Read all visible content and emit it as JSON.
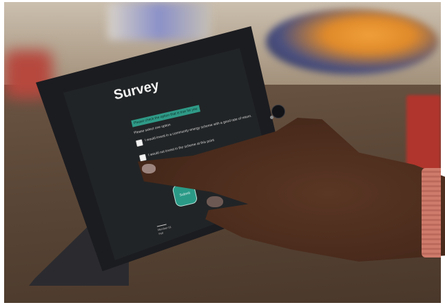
{
  "survey": {
    "title": "Survey",
    "hint": "Please check the option that is true for you",
    "instruction": "Please select one option",
    "options": [
      {
        "label": "I would invest in a community energy scheme with a good rate of return."
      },
      {
        "label": "I would not invest in the scheme at this point"
      }
    ],
    "submit_label": "Submit",
    "footer": {
      "line1": "Member 01",
      "line2": "Poll"
    }
  },
  "icons": {
    "home_button": "home-button-icon",
    "checkbox": "checkbox-icon"
  },
  "colors": {
    "accent": "#2f9a87",
    "screen_bg": "#212426"
  }
}
